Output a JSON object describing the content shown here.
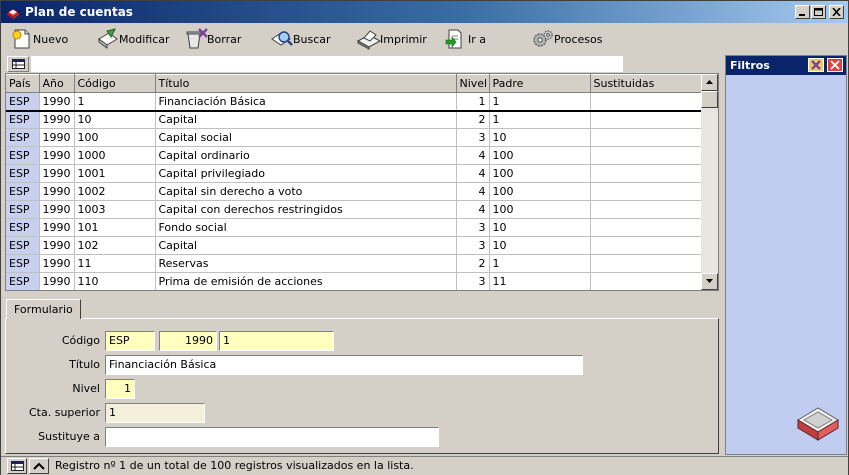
{
  "window": {
    "title": "Plan de cuentas"
  },
  "toolbar": {
    "nuevo": "Nuevo",
    "modificar": "Modificar",
    "borrar": "Borrar",
    "buscar": "Buscar",
    "imprimir": "Imprimir",
    "ir_a": "Ir a",
    "procesos": "Procesos"
  },
  "filter": {
    "value": ""
  },
  "grid": {
    "columns": [
      "País",
      "Año",
      "Código",
      "Título",
      "Nivel",
      "Padre",
      "Sustituidas"
    ],
    "rows": [
      [
        "ESP",
        "1990",
        "1",
        "Financiación Básica",
        "1",
        "1",
        ""
      ],
      [
        "ESP",
        "1990",
        "10",
        "Capital",
        "2",
        "1",
        ""
      ],
      [
        "ESP",
        "1990",
        "100",
        "Capital social",
        "3",
        "10",
        ""
      ],
      [
        "ESP",
        "1990",
        "1000",
        "Capital ordinario",
        "4",
        "100",
        ""
      ],
      [
        "ESP",
        "1990",
        "1001",
        "Capital privilegiado",
        "4",
        "100",
        ""
      ],
      [
        "ESP",
        "1990",
        "1002",
        "Capital sin derecho a voto",
        "4",
        "100",
        ""
      ],
      [
        "ESP",
        "1990",
        "1003",
        "Capital con derechos restringidos",
        "4",
        "100",
        ""
      ],
      [
        "ESP",
        "1990",
        "101",
        "Fondo social",
        "3",
        "10",
        ""
      ],
      [
        "ESP",
        "1990",
        "102",
        "Capital",
        "3",
        "10",
        ""
      ],
      [
        "ESP",
        "1990",
        "11",
        "Reservas",
        "2",
        "1",
        ""
      ],
      [
        "ESP",
        "1990",
        "110",
        "Prima de emisión de acciones",
        "3",
        "11",
        ""
      ]
    ]
  },
  "form": {
    "tab": "Formulario",
    "codigo_label": "Código",
    "codigo_pais": "ESP",
    "codigo_anio": "1990",
    "codigo_codigo": "1",
    "titulo_label": "Título",
    "titulo": "Financiación Básica",
    "nivel_label": "Nivel",
    "nivel": "1",
    "cta_label": "Cta. superior",
    "cta": "1",
    "sustituye_label": "Sustituye a",
    "sustituye": ""
  },
  "filters": {
    "title": "Filtros"
  },
  "status": {
    "text": "Registro nº 1 de un total de 100 registros visualizados en la lista."
  }
}
